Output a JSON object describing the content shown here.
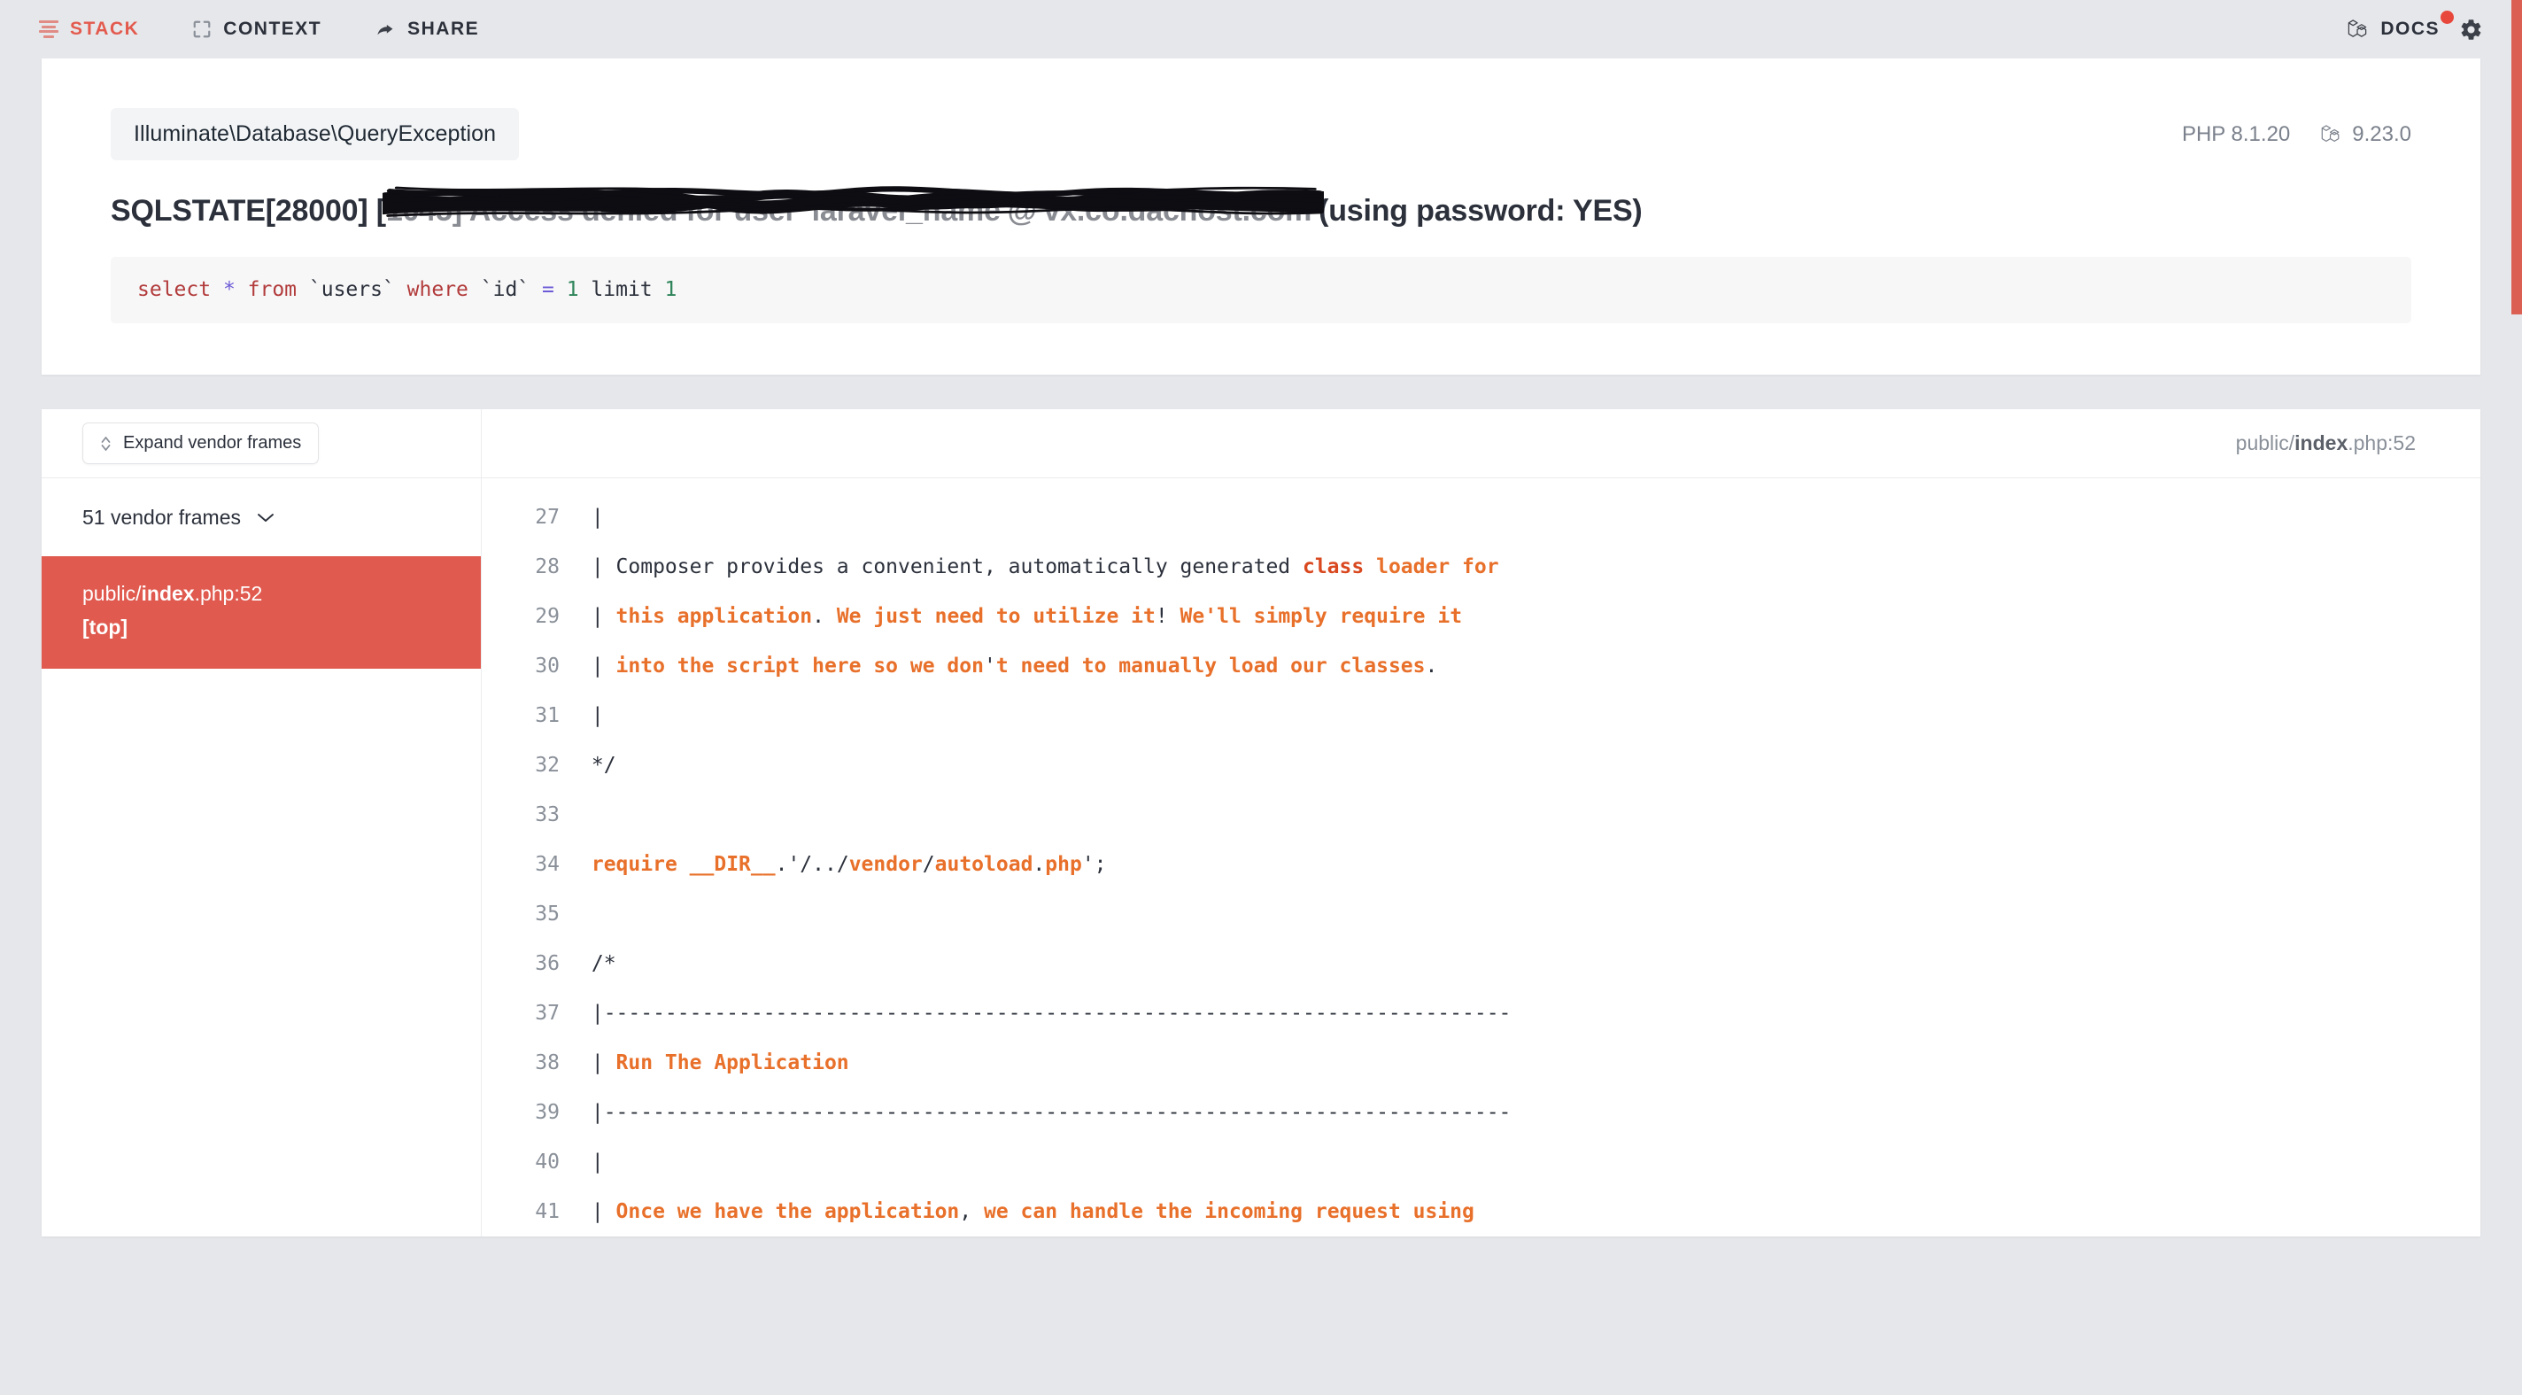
{
  "topnav": {
    "items": [
      {
        "label": "STACK",
        "icon": "stack-icon",
        "active": true
      },
      {
        "label": "CONTEXT",
        "icon": "context-icon",
        "active": false
      },
      {
        "label": "SHARE",
        "icon": "share-icon",
        "active": false
      }
    ],
    "docs": {
      "label": "DOCS",
      "icon": "laravel-icon",
      "badge": true
    },
    "settings_icon": "gear-icon"
  },
  "exception": {
    "class": "Illuminate\\Database\\QueryException",
    "php_label": "PHP 8.1.20",
    "laravel_version": "9.23.0",
    "laravel_icon": "laravel-icon",
    "message_prefix": "SQLSTATE[28000] [",
    "message_redacted": "1045] Access denied for user 'laravel_name'@'vx.co.dachost.com'",
    "message_suffix": "(using password: YES)",
    "sql": {
      "tokens": [
        {
          "text": "select ",
          "type": "keyword"
        },
        {
          "text": "* ",
          "type": "star"
        },
        {
          "text": "from ",
          "type": "keyword"
        },
        {
          "text": "`users` ",
          "type": "ident"
        },
        {
          "text": "where ",
          "type": "keyword"
        },
        {
          "text": "`id` ",
          "type": "ident"
        },
        {
          "text": "= ",
          "type": "operator"
        },
        {
          "text": "1 ",
          "type": "number"
        },
        {
          "text": "limit ",
          "type": "ident"
        },
        {
          "text": "1",
          "type": "number"
        }
      ]
    }
  },
  "stack": {
    "expand_button": {
      "label": "Expand vendor frames",
      "icon": "chevron-updown-icon"
    },
    "vendor_frames": {
      "label": "51 vendor frames",
      "icon": "chevron-down-icon"
    },
    "frames": [
      {
        "dir": "public",
        "sep": "/",
        "file": "index",
        "ext": ".php",
        "colon": ":",
        "line": "52",
        "badge": "[top]",
        "selected": true
      }
    ],
    "code_header": {
      "dir": "public",
      "sep": "/",
      "file": "index",
      "ext": ".php",
      "colon": ":",
      "line": "52"
    },
    "code_lines": [
      {
        "no": "27",
        "tokens": [
          {
            "t": " |",
            "c": "plain"
          }
        ]
      },
      {
        "no": "28",
        "tokens": [
          {
            "t": " | Composer provides a convenient, automatically generated ",
            "c": "plain"
          },
          {
            "t": "class",
            "c": "kw"
          },
          {
            "t": " ",
            "c": "plain"
          },
          {
            "t": "loader for",
            "c": "hl"
          }
        ]
      },
      {
        "no": "29",
        "tokens": [
          {
            "t": " | ",
            "c": "plain"
          },
          {
            "t": "this application",
            "c": "hl"
          },
          {
            "t": ".",
            "c": "plain"
          },
          {
            "t": " We just need to utilize it",
            "c": "hl"
          },
          {
            "t": "!",
            "c": "plain"
          },
          {
            "t": " We'll simply require it",
            "c": "hl"
          }
        ]
      },
      {
        "no": "30",
        "tokens": [
          {
            "t": " | ",
            "c": "plain"
          },
          {
            "t": "into the script here so we don",
            "c": "hl"
          },
          {
            "t": "'",
            "c": "plain"
          },
          {
            "t": "t need to manually load our classes",
            "c": "hl"
          },
          {
            "t": ".",
            "c": "plain"
          }
        ]
      },
      {
        "no": "31",
        "tokens": [
          {
            "t": " |",
            "c": "plain"
          }
        ]
      },
      {
        "no": "32",
        "tokens": [
          {
            "t": " */",
            "c": "plain"
          }
        ]
      },
      {
        "no": "33",
        "tokens": [
          {
            "t": "",
            "c": "plain"
          }
        ]
      },
      {
        "no": "34",
        "tokens": [
          {
            "t": " ",
            "c": "plain"
          },
          {
            "t": "require",
            "c": "hl"
          },
          {
            "t": " ",
            "c": "plain"
          },
          {
            "t": "__DIR__",
            "c": "hl"
          },
          {
            "t": ".'/../",
            "c": "plain"
          },
          {
            "t": "vendor",
            "c": "hl"
          },
          {
            "t": "/",
            "c": "plain"
          },
          {
            "t": "autoload",
            "c": "hl"
          },
          {
            "t": ".",
            "c": "plain"
          },
          {
            "t": "php",
            "c": "hl"
          },
          {
            "t": "';",
            "c": "plain"
          }
        ]
      },
      {
        "no": "35",
        "tokens": [
          {
            "t": "",
            "c": "plain"
          }
        ]
      },
      {
        "no": "36",
        "tokens": [
          {
            "t": " /*",
            "c": "plain"
          }
        ]
      },
      {
        "no": "37",
        "tokens": [
          {
            "t": " |--------------------------------------------------------------------------",
            "c": "plain"
          }
        ]
      },
      {
        "no": "38",
        "tokens": [
          {
            "t": " | ",
            "c": "plain"
          },
          {
            "t": "Run The Application",
            "c": "hl"
          }
        ]
      },
      {
        "no": "39",
        "tokens": [
          {
            "t": " |--------------------------------------------------------------------------",
            "c": "plain"
          }
        ]
      },
      {
        "no": "40",
        "tokens": [
          {
            "t": " |",
            "c": "plain"
          }
        ]
      },
      {
        "no": "41",
        "tokens": [
          {
            "t": " | ",
            "c": "plain"
          },
          {
            "t": "Once we have the application",
            "c": "hl"
          },
          {
            "t": ",",
            "c": "plain"
          },
          {
            "t": " we can handle the incoming request using",
            "c": "hl"
          }
        ]
      }
    ]
  },
  "colors": {
    "accent_red": "#e05a4f",
    "page_bg": "#e6e7ea",
    "card_bg": "#ffffff",
    "code_highlight": "#e8702a",
    "scrollbar": "#dc5f53"
  }
}
